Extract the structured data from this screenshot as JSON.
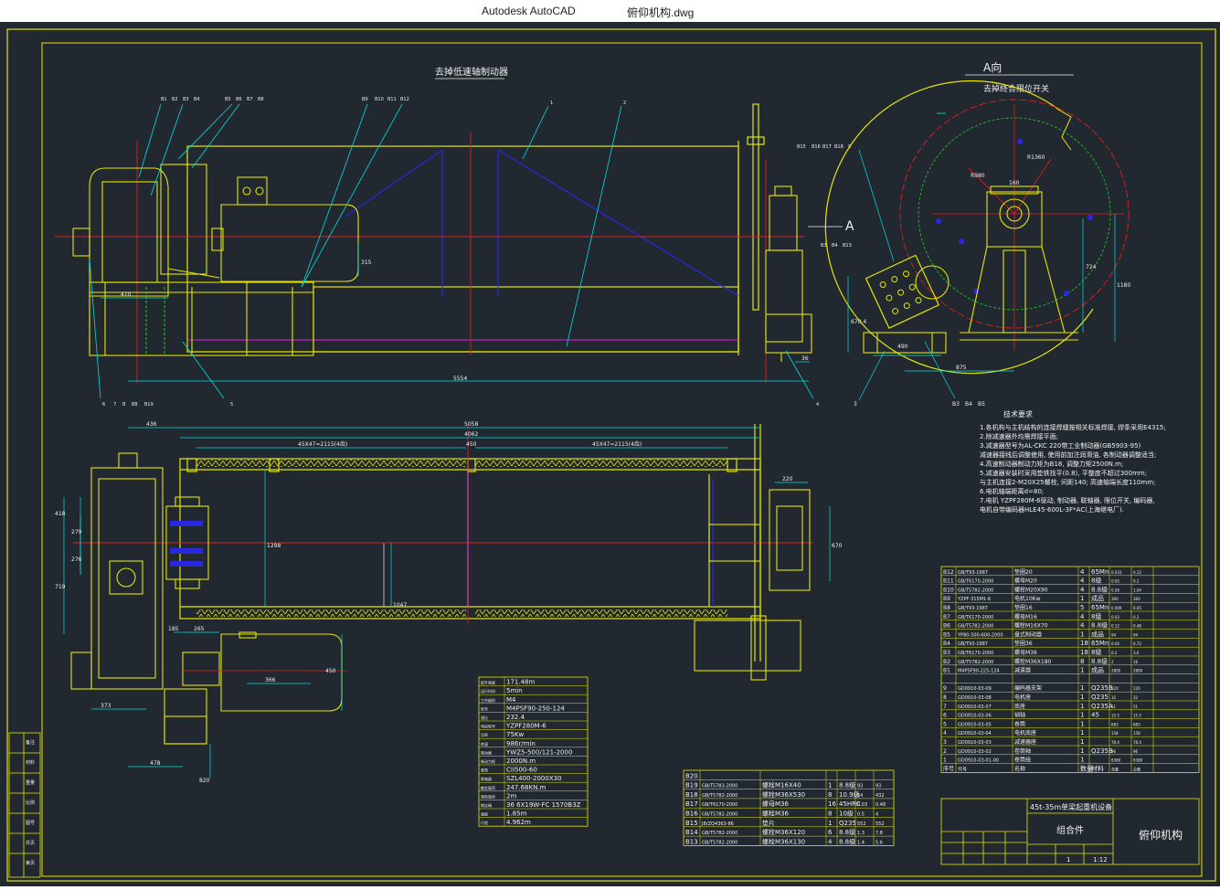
{
  "window": {
    "app_title": "Autodesk AutoCAD",
    "document_title": "俯仰机构.dwg"
  },
  "colors": {
    "background": "#212830",
    "yellow": "#e6e600",
    "red": "#e02020",
    "cyan": "#00e0e0",
    "white": "#f0f0f0",
    "blue": "#2828e0",
    "green": "#20d020",
    "magenta": "#e020e0"
  },
  "drawing": {
    "notes": {
      "label_lowspeed_brake": "去掉低速轴制动器",
      "label_view_a": "A向",
      "label_limit_switch": "去掉终合限位开关",
      "section_marker": "A",
      "tech_title": "技术要求",
      "tech_lines": [
        "1.各机构与主机结构的连接焊缝按相关标准焊接, 焊条采用E4315;",
        "2.除减速器外均需焊接平面;",
        "3.减速器型号为AL-CKC 220带工业制动器(GB5903-95)",
        "减速器接线后调整使用, 使用前加注润滑油, 各制动器调整适当;",
        "4.高速制动器制动力矩为B18, 调整力矩2500N.m;",
        "5.减速器安装时采用垫铁找平(0.8), 平整度不超过300mm;",
        "与主机连接2-M20X25螺栓, 间距140; 高速轴端长度110mm;",
        "6.电机轴端距离d=80;",
        "7.电机 YZPF280M-6驱动, 制动器, 联轴器, 限位开关, 编码器,",
        "电机自带编码器HLE45-600L-3F*AC(上海继电厂)."
      ]
    },
    "dimensions": {
      "d_410": "410",
      "d_5554": "5554",
      "d_315": "315",
      "d_36": "36",
      "d_436": "436",
      "d_5058": "5058",
      "d_4062": "4062",
      "d_450": "450",
      "d_span_left": "45X47=2115(4齿)",
      "d_span_right": "45X47=2115(4齿)",
      "d_1298": "1298",
      "d_1047": "1047",
      "d_220": "220",
      "d_670": "670",
      "d_418": "418",
      "d_279": "279",
      "d_276": "276",
      "d_719": "719",
      "d_373": "373",
      "d_478": "478",
      "d_185": "185",
      "d_265": "265",
      "d_366": "366",
      "d_450b": "450",
      "d_820": "820",
      "d_490": "490",
      "d_875": "875",
      "d_6704": "670.4",
      "d_724": "724",
      "d_1180": "1180",
      "d_160": "160",
      "d_r980": "R980",
      "d_r1360": "R1360"
    },
    "balloons": {
      "top_row": [
        "B1",
        "B2",
        "B3",
        "B4",
        "B5",
        "B6",
        "B7",
        "B8",
        "B9",
        "B10",
        "B11",
        "B12"
      ],
      "front": [
        "1",
        "2"
      ],
      "bottom_row": [
        "6",
        "7",
        "B",
        "B8",
        "B19",
        "5"
      ],
      "side_top": [
        "B15",
        "B16",
        "B17",
        "B18",
        "9"
      ],
      "side_mid": [
        "B3",
        "B4",
        "B13"
      ],
      "side_bottom": [
        "B3",
        "B4",
        "B5"
      ],
      "mark_3": "3",
      "mark_4": "4"
    },
    "perf_table": {
      "rows": [
        [
          "起升高度",
          "171.48m"
        ],
        [
          "运行时间",
          "5min"
        ],
        [
          "工作级别",
          "M4"
        ],
        [
          "型号",
          "M4PSF90-250-124"
        ],
        [
          "速比",
          "232.4"
        ],
        [
          "电机型号",
          "YZPF280M-6"
        ],
        [
          "功率",
          "75Kw"
        ],
        [
          "转速",
          "986r/min"
        ],
        [
          "制动器",
          "YWZ5-500/121-2000"
        ],
        [
          "制动力矩",
          "2000N.m"
        ],
        [
          "卷筒",
          "CII500-60"
        ],
        [
          "联轴器",
          "SZL400-2000X30"
        ],
        [
          "额定载荷",
          "247.68KN.m"
        ],
        [
          "滑轮直径",
          "2m"
        ],
        [
          "钢丝绳",
          "36 6X19W-FC 1570B3Z"
        ],
        [
          "速度",
          "1.85m"
        ],
        [
          "行程",
          "4.962m"
        ]
      ]
    },
    "bom_lower": {
      "rows": [
        [
          "B20",
          "",
          "",
          "",
          "",
          "",
          ""
        ],
        [
          "B19",
          "GB/T5783-2000",
          "螺栓M16X40",
          "1",
          "8.8级",
          "93",
          "93"
        ],
        [
          "B18",
          "GB/T5782-2000",
          "螺栓M36X530",
          "8",
          "10.9级",
          "54",
          "432"
        ],
        [
          "B17",
          "GB/T6170-2000",
          "螺母M36",
          "16",
          "45HRC",
          "0.03",
          "0.48"
        ],
        [
          "B16",
          "GB/T5782-2000",
          "螺栓M36",
          "8",
          "10级",
          "0.5",
          "4"
        ],
        [
          "B15",
          "JB/ZQ4363-86",
          "垫片",
          "1",
          "Q235",
          "552",
          "552"
        ],
        [
          "B14",
          "GB/T5782-2000",
          "螺栓M36X120",
          "6",
          "8.8级",
          "1.3",
          "7.8"
        ],
        [
          "B13",
          "GB/T5782-2000",
          "螺栓M36X130",
          "4",
          "8.8级",
          "1.4",
          "5.6"
        ]
      ]
    },
    "bom_right": {
      "rows": [
        [
          "B12",
          "GB/T93-1987",
          "垫圈20",
          "4",
          "65Mn",
          "0.033",
          "0.12"
        ],
        [
          "B11",
          "GB/T6170-2000",
          "螺母M20",
          "4",
          "8级",
          "0.05",
          "0.2"
        ],
        [
          "B10",
          "GB/T5782-2000",
          "螺栓M20X90",
          "4",
          "8.8级",
          "0.26",
          "1.04"
        ],
        [
          "B9",
          "YZPF-315M1-6",
          "电机10Kw",
          "1",
          "成品",
          "300",
          "360"
        ],
        [
          "B8",
          "GB/T93-1987",
          "垫圈16",
          "5",
          "65Mn",
          "0.009",
          "0.05"
        ],
        [
          "B7",
          "GB/T6170-2000",
          "螺母M16",
          "4",
          "8级",
          "0.03",
          "0.2"
        ],
        [
          "B6",
          "GB/T5782-2000",
          "螺栓M16X70",
          "4",
          "8.8级",
          "0.12",
          "0.48"
        ],
        [
          "B5",
          "YP80-500-600-2000",
          "盘式制动器",
          "1",
          "成品",
          "94",
          "94"
        ],
        [
          "B4",
          "GB/T93-1987",
          "垫圈36",
          "18",
          "65Mn",
          "0.04",
          "0.72"
        ],
        [
          "B3",
          "GB/T6170-2000",
          "螺母M36",
          "18",
          "8级",
          "0.2",
          "3.6"
        ],
        [
          "B2",
          "GB/T5782-2000",
          "螺栓M36X180",
          "8",
          "8.8级",
          "2",
          "16"
        ],
        [
          "B1",
          "M4PSF90-225-124",
          "减速器",
          "1",
          "成品",
          "2800",
          "2800"
        ],
        [
          "",
          "",
          "",
          "",
          "",
          "",
          ""
        ],
        [
          "9",
          "GD0910-03-09",
          "编码器支架",
          "1",
          "Q235B",
          "120",
          "120"
        ],
        [
          "8",
          "GD0910-03-08",
          "电机座",
          "1",
          "Q235",
          "32",
          "32"
        ],
        [
          "7",
          "GD0910-03-07",
          "底座",
          "1",
          "Q235A",
          "51",
          "51"
        ],
        [
          "6",
          "GD0910-03-06",
          "销轴",
          "1",
          "45",
          "15.5",
          "15.5"
        ],
        [
          "5",
          "GD0910-03-05",
          "卷筒",
          "1",
          "",
          "683",
          "683"
        ],
        [
          "4",
          "GD0910-03-04",
          "电机底座",
          "1",
          "",
          "158",
          "158"
        ],
        [
          "3",
          "GD0910-03-03",
          "减速器座",
          "1",
          "",
          "78.4",
          "78.4"
        ],
        [
          "2",
          "GD0910-03-02",
          "卷筒轴",
          "1",
          "Q235B",
          "96",
          "96"
        ],
        [
          "1",
          "GD0910-03-01-00",
          "卷筒组",
          "1",
          "",
          "6380",
          "6380"
        ]
      ],
      "header": [
        "序号",
        "代号",
        "名称",
        "数量",
        "材料",
        "单重",
        "总重"
      ]
    },
    "title_block": {
      "project": "45t-35m单梁起重机设备",
      "assembly": "组合件",
      "name": "俯仰机构",
      "quantity": "1",
      "scale": "1:12"
    },
    "left_strip": [
      "备注",
      "材料",
      "重量",
      "比例",
      "图号",
      "共页",
      "第页"
    ]
  }
}
